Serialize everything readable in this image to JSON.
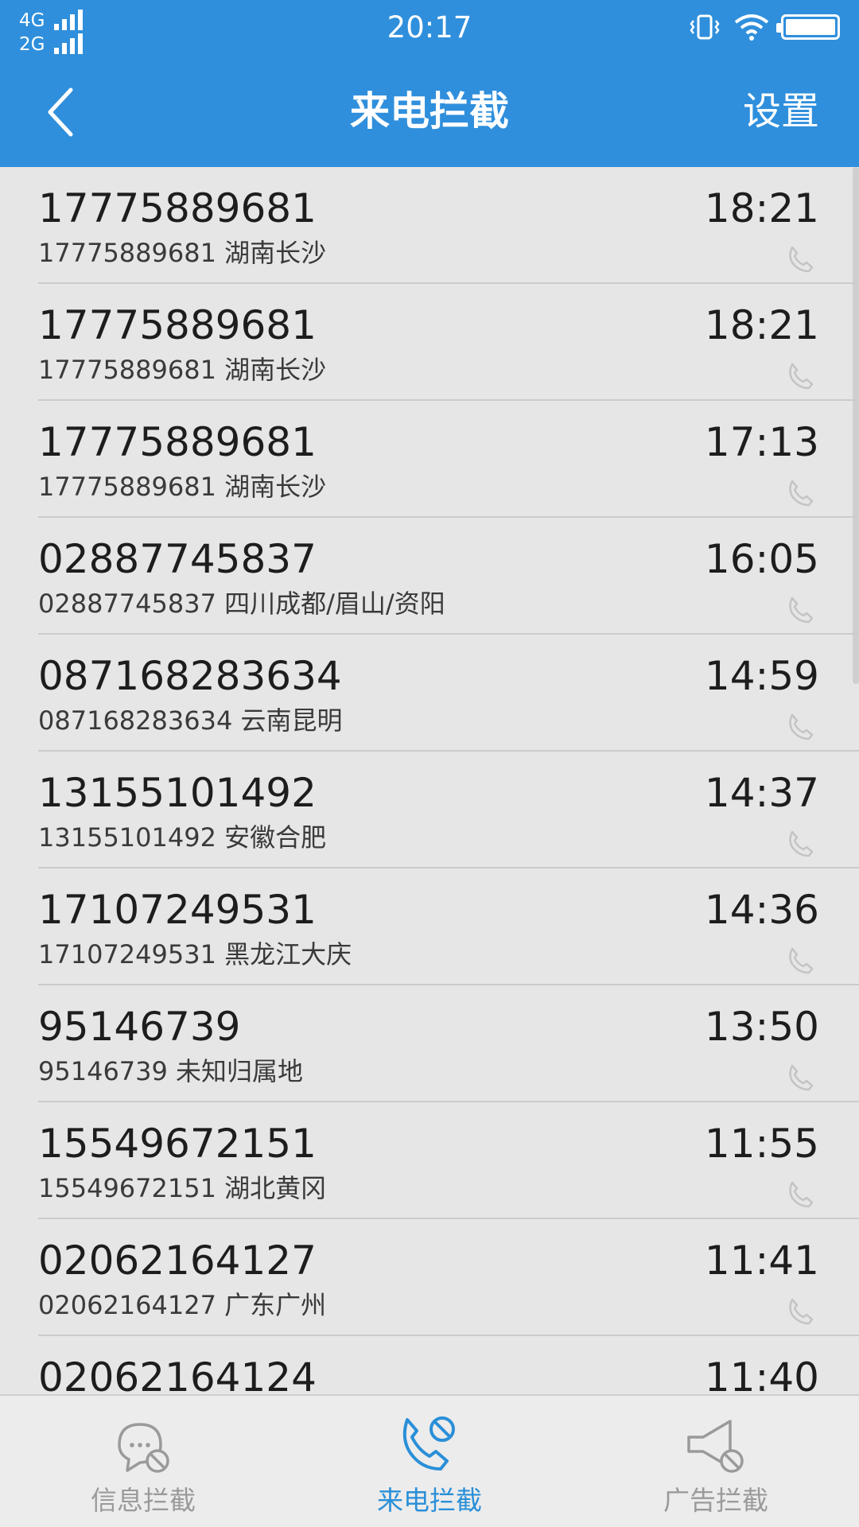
{
  "status_bar": {
    "network_1": "4G",
    "network_2": "2G",
    "time": "20:17",
    "icons": [
      "signal-icon",
      "vibrate-icon",
      "wifi-icon",
      "battery-icon"
    ]
  },
  "header": {
    "title": "来电拦截",
    "settings_label": "设置",
    "back_icon": "chevron-left-icon"
  },
  "colors": {
    "header_bg": "#2f8fdc",
    "active_tab": "#2a8fd8",
    "inactive_tab": "#9a9a9a",
    "list_bg": "#e6e6e6"
  },
  "calls": [
    {
      "number": "17775889681",
      "detail": "17775889681 湖南长沙",
      "time": "18:21"
    },
    {
      "number": "17775889681",
      "detail": "17775889681 湖南长沙",
      "time": "18:21"
    },
    {
      "number": "17775889681",
      "detail": "17775889681 湖南长沙",
      "time": "17:13"
    },
    {
      "number": "02887745837",
      "detail": "02887745837 四川成都/眉山/资阳",
      "time": "16:05"
    },
    {
      "number": "087168283634",
      "detail": "087168283634 云南昆明",
      "time": "14:59"
    },
    {
      "number": "13155101492",
      "detail": "13155101492 安徽合肥",
      "time": "14:37"
    },
    {
      "number": "17107249531",
      "detail": "17107249531 黑龙江大庆",
      "time": "14:36"
    },
    {
      "number": "95146739",
      "detail": "95146739 未知归属地",
      "time": "13:50"
    },
    {
      "number": "15549672151",
      "detail": "15549672151 湖北黄冈",
      "time": "11:55"
    },
    {
      "number": "02062164127",
      "detail": "02062164127 广东广州",
      "time": "11:41"
    },
    {
      "number": "02062164124",
      "detail": "",
      "time": "11:40"
    }
  ],
  "bottom_nav": {
    "tabs": [
      {
        "label": "信息拦截",
        "icon": "message-block-icon",
        "active": false
      },
      {
        "label": "来电拦截",
        "icon": "phone-block-icon",
        "active": true
      },
      {
        "label": "广告拦截",
        "icon": "speaker-block-icon",
        "active": false
      }
    ]
  }
}
